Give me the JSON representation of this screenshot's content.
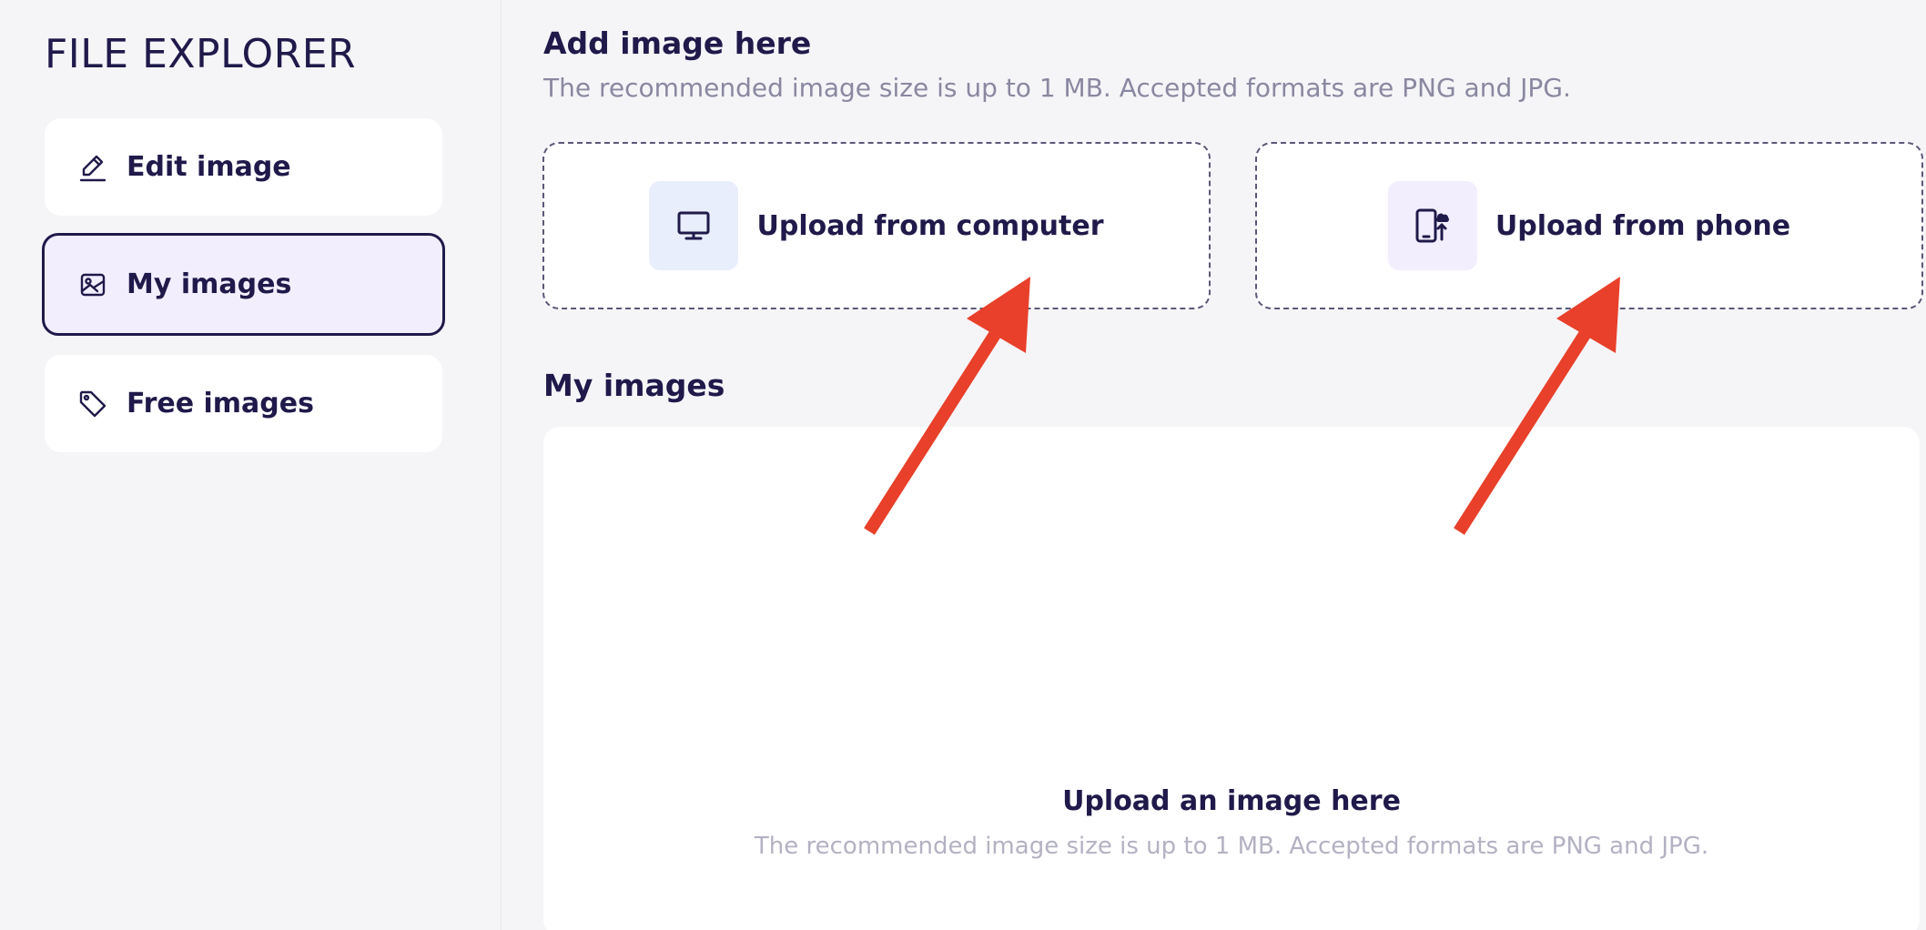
{
  "sidebar": {
    "title": "FILE EXPLORER",
    "items": [
      {
        "label": "Edit image",
        "icon": "pencil-icon",
        "active": false
      },
      {
        "label": "My images",
        "icon": "image-icon",
        "active": true
      },
      {
        "label": "Free images",
        "icon": "tag-icon",
        "active": false
      }
    ]
  },
  "main": {
    "add_section": {
      "heading": "Add image here",
      "hint": "The recommended image size is up to 1 MB. Accepted formats are PNG and JPG.",
      "cards": [
        {
          "label": "Upload from computer",
          "icon": "monitor-icon",
          "icon_bg": "#e8eefc"
        },
        {
          "label": "Upload from phone",
          "icon": "phone-upload-icon",
          "icon_bg": "#f3eefd"
        }
      ]
    },
    "images_section": {
      "heading": "My images",
      "empty_title": "Upload an image here",
      "empty_hint": "The recommended image size is up to 1 MB. Accepted formats are PNG and JPG."
    }
  },
  "colors": {
    "primary_text": "#1f1a4a",
    "muted_text": "#8a88a0",
    "active_bg": "#f3eefd",
    "annotation_arrow": "#e8402a"
  }
}
